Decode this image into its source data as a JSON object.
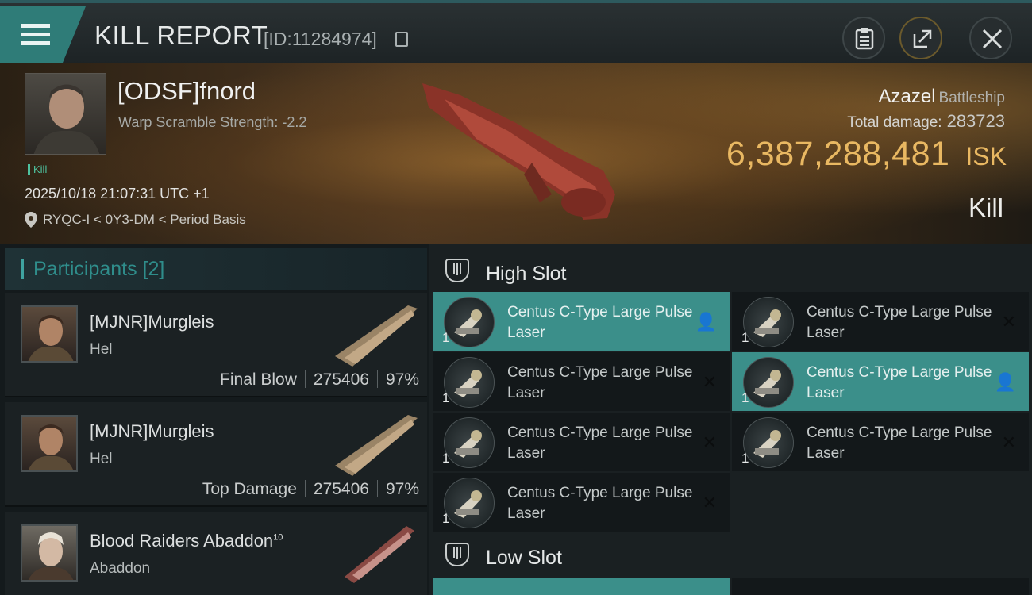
{
  "header": {
    "title": "KILL REPORT",
    "report_id": "[ID:11284974]"
  },
  "victim": {
    "name": "[ODSF]fnord",
    "warp_scramble": "Warp Scramble Strength: -2.2",
    "tag": "Kill",
    "datetime": "2025/10/18 21:07:31 UTC +1",
    "location": "RYQC-I < 0Y3-DM < Period Basis",
    "ship_name": "Azazel",
    "ship_class": "Battleship",
    "total_damage_label": "Total damage:",
    "total_damage": "283723",
    "isk_value": "6,387,288,481",
    "isk_unit": "ISK",
    "result": "Kill"
  },
  "participants": {
    "label": "Participants",
    "count": "[2]",
    "rows": [
      {
        "name": "[MJNR]Murgleis",
        "ship": "Hel",
        "role": "Final Blow",
        "damage": "275406",
        "percent": "97%"
      },
      {
        "name": "[MJNR]Murgleis",
        "ship": "Hel",
        "role": "Top Damage",
        "damage": "275406",
        "percent": "97%"
      },
      {
        "name": "Blood Raiders Abaddon",
        "level": "10",
        "ship": "Abaddon"
      }
    ]
  },
  "slots": {
    "high": {
      "label": "High Slot",
      "modules": [
        {
          "name": "Centus C-Type Large Pulse Laser",
          "qty": "1",
          "state": "dropped"
        },
        {
          "name": "Centus C-Type Large Pulse Laser",
          "qty": "1",
          "state": "destroyed"
        },
        {
          "name": "Centus C-Type Large Pulse Laser",
          "qty": "1",
          "state": "destroyed"
        },
        {
          "name": "Centus C-Type Large Pulse Laser",
          "qty": "1",
          "state": "dropped"
        },
        {
          "name": "Centus C-Type Large Pulse Laser",
          "qty": "1",
          "state": "destroyed"
        },
        {
          "name": "Centus C-Type Large Pulse Laser",
          "qty": "1",
          "state": "destroyed"
        },
        {
          "name": "Centus C-Type Large Pulse Laser",
          "qty": "1",
          "state": "destroyed"
        }
      ]
    },
    "low": {
      "label": "Low Slot"
    }
  },
  "colors": {
    "accent_teal": "#3b8f8a",
    "isk_gold": "#e9b862",
    "kill_green": "#4ec29f"
  }
}
